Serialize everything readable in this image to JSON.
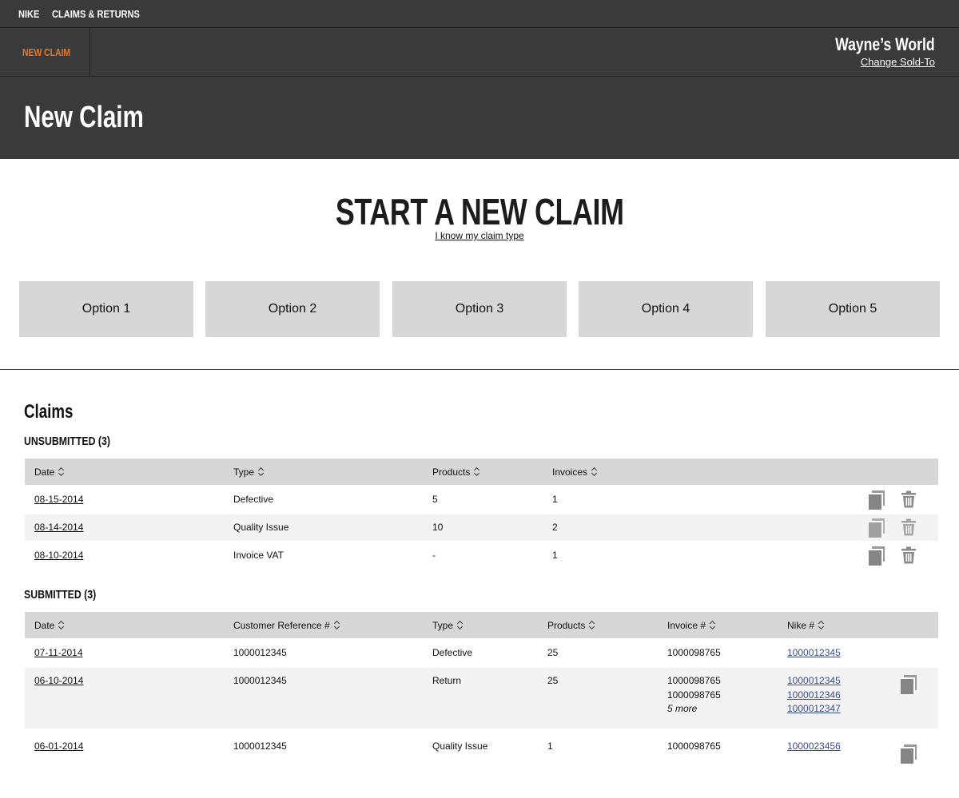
{
  "topnav": {
    "brand": "NIKE",
    "section": "CLAIMS & RETURNS"
  },
  "subbar": {
    "active_tab": "NEW CLAIM",
    "account_name": "Wayne’s  World",
    "change_link": "Change Sold-To"
  },
  "header": {
    "title": "New Claim"
  },
  "start": {
    "title": "START A NEW CLAIM",
    "know_link": "I know my claim type",
    "options": [
      "Option 1",
      "Option 2",
      "Option 3",
      "Option 4",
      "Option 5"
    ]
  },
  "claims": {
    "title": "Claims",
    "unsubmitted": {
      "title": "UNSUBMITTED (3)",
      "columns": [
        "Date",
        "Type",
        "Products",
        "Invoices"
      ],
      "rows": [
        {
          "date": "08-15-2014",
          "type": "Defective",
          "products": "5",
          "invoices": "1"
        },
        {
          "date": "08-14-2014",
          "type": "Quality Issue",
          "products": "10",
          "invoices": "2"
        },
        {
          "date": "08-10-2014",
          "type": "Invoice VAT",
          "products": "-",
          "invoices": "1"
        }
      ]
    },
    "submitted": {
      "title": "SUBMITTED (3)",
      "columns": [
        "Date",
        "Customer Reference #",
        "Type",
        "Products",
        "Invoice #",
        "Nike #"
      ],
      "rows": [
        {
          "date": "07-11-2014",
          "customer_ref": "1000012345",
          "type": "Defective",
          "products": "25",
          "invoices": [
            "1000098765"
          ],
          "nike": [
            "1000012345"
          ]
        },
        {
          "date": "06-10-2014",
          "customer_ref": "1000012345",
          "type": "Return",
          "products": "25",
          "invoices": [
            "1000098765",
            "1000098765"
          ],
          "invoices_more": "5 more",
          "nike": [
            "1000012345",
            "1000012346",
            "1000012347"
          ]
        },
        {
          "date": "06-01-2014",
          "customer_ref": "1000012345",
          "type": "Quality Issue",
          "products": "1",
          "invoices": [
            "1000098765"
          ],
          "nike": [
            "1000023456"
          ]
        }
      ]
    }
  },
  "icons": {
    "copy": "copy-icon",
    "delete": "trash-icon"
  },
  "colors": {
    "dark_bg": "#3a3a3a",
    "accent": "#e0782f",
    "option_bg": "#d7d7d7",
    "link_blue": "#3a4f8a",
    "row_alt": "#f3f3f3"
  }
}
